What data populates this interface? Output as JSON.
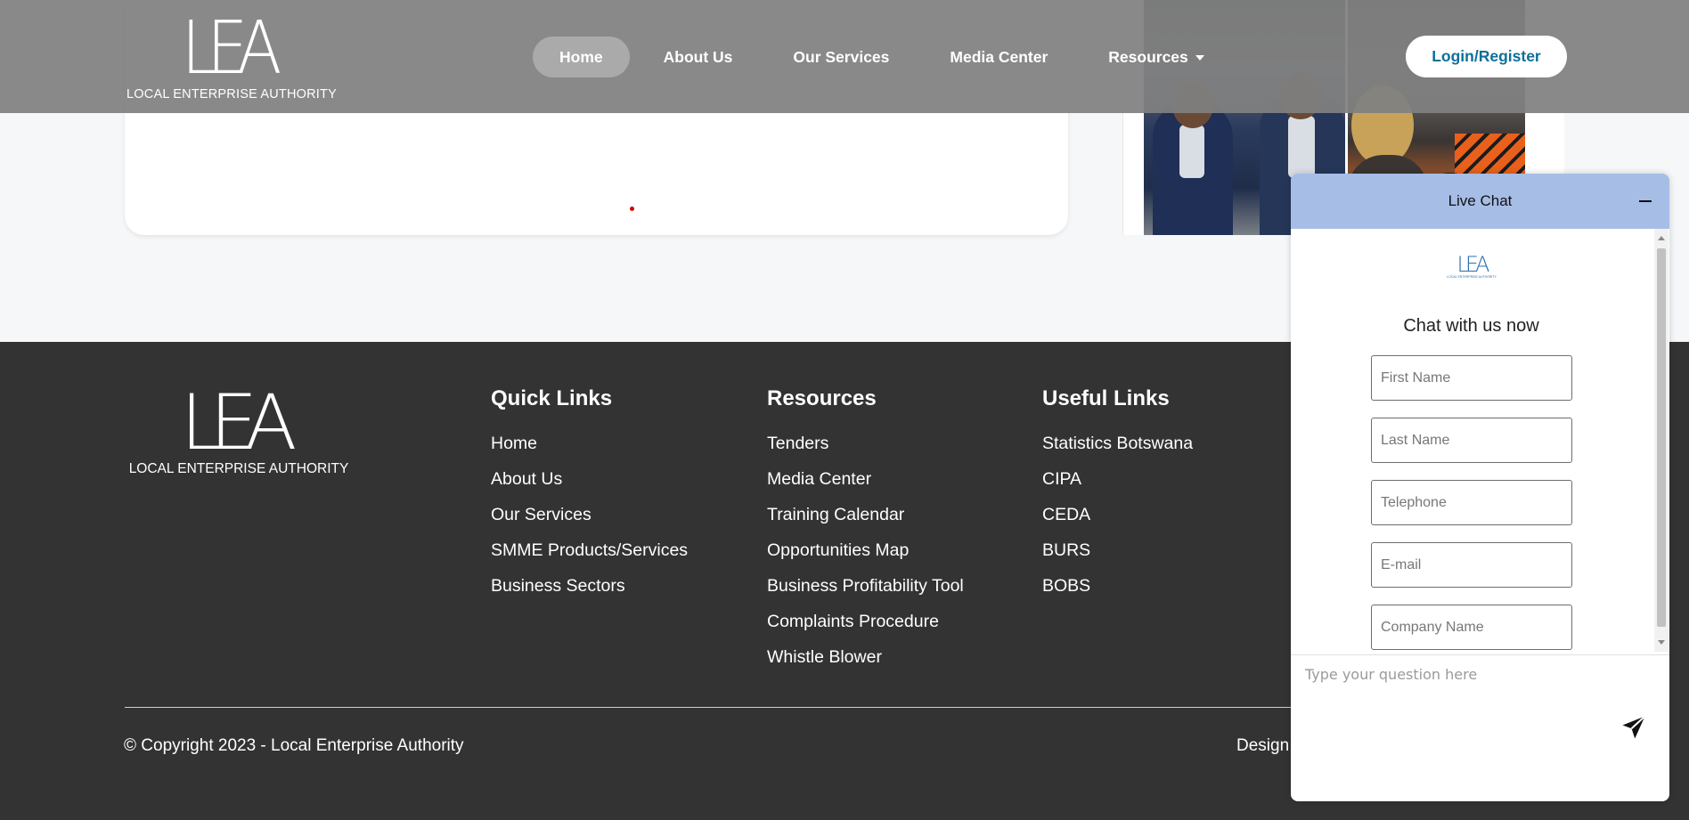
{
  "header": {
    "logo": {
      "mark": "LEA",
      "subtitle": "LOCAL ENTERPRISE AUTHORITY"
    },
    "nav": [
      {
        "label": "Home",
        "active": true
      },
      {
        "label": "About Us"
      },
      {
        "label": "Our Services"
      },
      {
        "label": "Media Center"
      },
      {
        "label": "Resources",
        "has_dropdown": true
      }
    ],
    "login_label": "Login/Register"
  },
  "footer": {
    "logo": {
      "mark": "LEA",
      "subtitle": "LOCAL ENTERPRISE AUTHORITY"
    },
    "quick_links": {
      "title": "Quick Links",
      "items": [
        "Home",
        "About Us",
        "Our Services",
        "SMME Products/Services",
        "Business Sectors"
      ]
    },
    "resources": {
      "title": "Resources",
      "items": [
        "Tenders",
        "Media Center",
        "Training Calendar",
        "Opportunities Map",
        "Business Profitability Tool",
        "Complaints Procedure",
        "Whistle Blower"
      ]
    },
    "useful_links": {
      "title": "Useful Links",
      "items": [
        "Statistics Botswana",
        "CIPA",
        "CEDA",
        "BURS",
        "BOBS"
      ]
    },
    "copyright": "© Copyright 2023 - Local Enterprise Authority",
    "design_credit": "Design"
  },
  "chat": {
    "header_title": "Live Chat",
    "title": "Chat with us now",
    "logo": {
      "mark": "LEA",
      "subtitle": "LOCAL ENTERPRISE AUTHORITY"
    },
    "fields": {
      "first_name": "First Name",
      "last_name": "Last Name",
      "telephone": "Telephone",
      "email": "E-mail",
      "company": "Company Name"
    },
    "message_placeholder": "Type your question here"
  },
  "colors": {
    "header_overlay": "#808080",
    "footer_bg": "#333333",
    "chat_header": "#a6bde6",
    "login_text": "#0e6f9a",
    "accent_dot": "#d40000"
  },
  "icons": [
    "chevron-down-icon",
    "minimize-icon",
    "send-icon"
  ]
}
